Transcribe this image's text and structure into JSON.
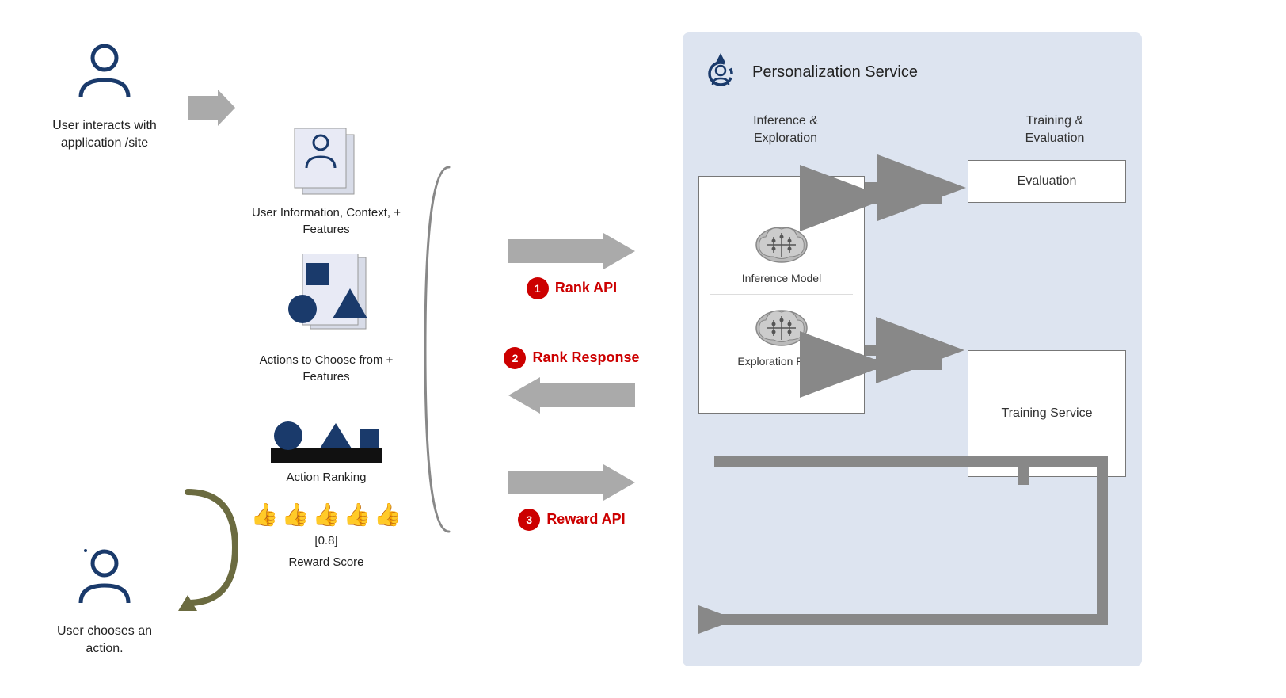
{
  "diagram": {
    "left": {
      "user1_label": "User interacts with application /site",
      "user2_label": "User chooses an action."
    },
    "features": {
      "block1_label": "User Information, Context,  + Features",
      "block2_label": "Actions to Choose from + Features",
      "block3_label": "Action Ranking",
      "block4_score": "[0.8]",
      "block4_label": "Reward Score"
    },
    "apis": {
      "rank_api_num": "1",
      "rank_api_label": "Rank API",
      "rank_response_num": "2",
      "rank_response_label": "Rank Response",
      "reward_api_num": "3",
      "reward_api_label": "Reward API"
    },
    "personalization": {
      "title": "Personalization Service",
      "col_left_label": "Inference &\nExploration",
      "col_right_label": "Training &\nEvaluation",
      "eval_label": "Evaluation",
      "training_label": "Training Service",
      "inference_model_label": "Inference Model",
      "exploration_policy_label": "Exploration Policy"
    }
  }
}
